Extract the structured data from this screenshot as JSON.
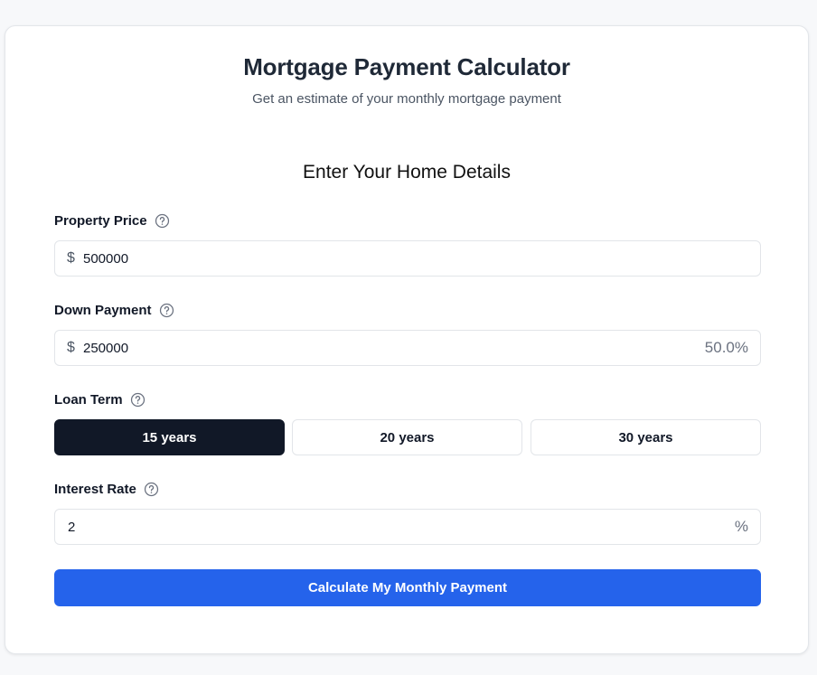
{
  "header": {
    "title": "Mortgage Payment Calculator",
    "subtitle": "Get an estimate of your monthly mortgage payment"
  },
  "form": {
    "section_title": "Enter Your Home Details",
    "property_price": {
      "label": "Property Price",
      "prefix": "$",
      "value": "500000"
    },
    "down_payment": {
      "label": "Down Payment",
      "prefix": "$",
      "value": "250000",
      "percent": "50.0%"
    },
    "loan_term": {
      "label": "Loan Term",
      "options": [
        "15 years",
        "20 years",
        "30 years"
      ],
      "selected": "15 years"
    },
    "interest_rate": {
      "label": "Interest Rate",
      "value": "2",
      "suffix": "%"
    },
    "submit_label": "Calculate My Monthly Payment"
  },
  "icons": {
    "help": "help-circle-icon"
  },
  "colors": {
    "primary": "#2563eb",
    "selected": "#111827"
  }
}
